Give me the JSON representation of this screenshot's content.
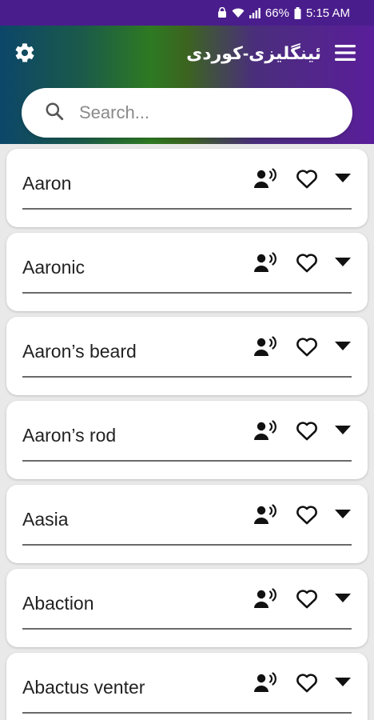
{
  "status_bar": {
    "battery": "66%",
    "time": "5:15 AM"
  },
  "header": {
    "title": "ئینگلیزی-کوردی",
    "settings_icon": "gear-icon",
    "menu_icon": "hamburger-menu-icon"
  },
  "search": {
    "placeholder": "Search...",
    "value": ""
  },
  "colors": {
    "status_bar": "#4a1d8c",
    "gradient_start": "#0c4669",
    "gradient_mid": "#2d7a22",
    "gradient_end": "#5a1e9a",
    "card_bg": "#ffffff",
    "page_bg": "#e9e9e9"
  },
  "entries": [
    {
      "word": "Aaron"
    },
    {
      "word": "Aaronic"
    },
    {
      "word": "Aaron’s beard"
    },
    {
      "word": "Aaron’s rod"
    },
    {
      "word": "Aasia"
    },
    {
      "word": "Abaction"
    },
    {
      "word": "Abactus venter"
    }
  ],
  "entry_icons": {
    "speak": "speak-icon",
    "favorite": "heart-outline-icon",
    "expand": "caret-down-icon"
  }
}
